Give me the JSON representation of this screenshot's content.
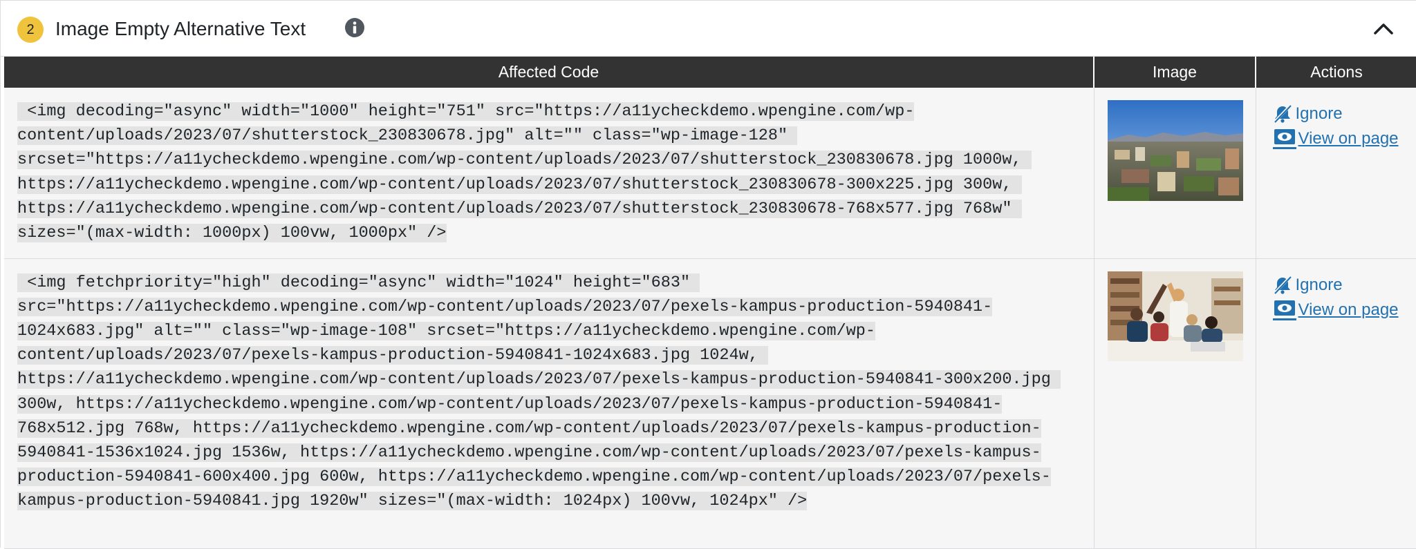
{
  "issue": {
    "count": "2",
    "title": "Image Empty Alternative Text",
    "info_icon": "info-icon",
    "collapse_icon": "chevron-up-icon"
  },
  "table": {
    "headers": [
      "Affected Code",
      "Image",
      "Actions"
    ],
    "rows": [
      {
        "code": " <img decoding=\"async\" width=\"1000\" height=\"751\" src=\"https://a11ycheckdemo.wpengine.com/wp-content/uploads/2023/07/shutterstock_230830678.jpg\" alt=\"\" class=\"wp-image-128\" srcset=\"https://a11ycheckdemo.wpengine.com/wp-content/uploads/2023/07/shutterstock_230830678.jpg 1000w, https://a11ycheckdemo.wpengine.com/wp-content/uploads/2023/07/shutterstock_230830678-300x225.jpg 300w, https://a11ycheckdemo.wpengine.com/wp-content/uploads/2023/07/shutterstock_230830678-768x577.jpg 768w\" sizes=\"(max-width: 1000px) 100vw, 1000px\" />",
        "image": "aerial-city-thumbnail",
        "ignore_label": "Ignore",
        "view_label": "View on page"
      },
      {
        "code": " <img fetchpriority=\"high\" decoding=\"async\" width=\"1024\" height=\"683\" src=\"https://a11ycheckdemo.wpengine.com/wp-content/uploads/2023/07/pexels-kampus-production-5940841-1024x683.jpg\" alt=\"\" class=\"wp-image-108\" srcset=\"https://a11ycheckdemo.wpengine.com/wp-content/uploads/2023/07/pexels-kampus-production-5940841-1024x683.jpg 1024w, https://a11ycheckdemo.wpengine.com/wp-content/uploads/2023/07/pexels-kampus-production-5940841-300x200.jpg 300w, https://a11ycheckdemo.wpengine.com/wp-content/uploads/2023/07/pexels-kampus-production-5940841-768x512.jpg 768w, https://a11ycheckdemo.wpengine.com/wp-content/uploads/2023/07/pexels-kampus-production-5940841-1536x1024.jpg 1536w, https://a11ycheckdemo.wpengine.com/wp-content/uploads/2023/07/pexels-kampus-production-5940841-600x400.jpg 600w, https://a11ycheckdemo.wpengine.com/wp-content/uploads/2023/07/pexels-kampus-production-5940841.jpg 1920w\" sizes=\"(max-width: 1024px) 100vw, 1024px\" />",
        "image": "students-high-five-thumbnail",
        "ignore_label": "Ignore",
        "view_label": "View on page"
      }
    ]
  },
  "colors": {
    "badge": "#f0c33c",
    "header_bg": "#333333",
    "link": "#2271b1",
    "row_bg": "#f6f6f6",
    "code_highlight": "#e3e3e3"
  }
}
